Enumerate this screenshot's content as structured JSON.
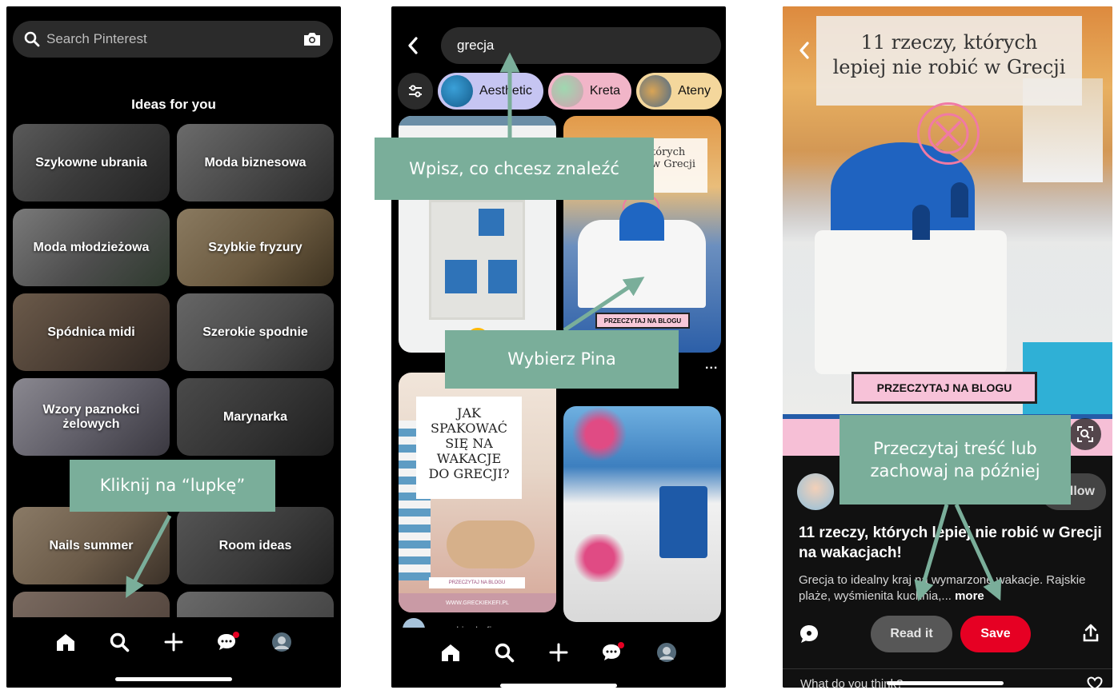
{
  "screen1": {
    "search_placeholder": "Search Pinterest",
    "ideas_title": "Ideas for you",
    "tiles": [
      "Szykowne ubrania",
      "Moda biznesowa",
      "Moda młodzieżowa",
      "Szybkie fryzury",
      "Spódnica midi",
      "Szerokie spodnie",
      "Wzory paznokci żelowych",
      "Marynarka",
      "Nails summer",
      "Room ideas"
    ],
    "callout": "Kliknij na “lupkę”"
  },
  "screen2": {
    "query": "grecja",
    "chips": [
      "Aesthetic",
      "Kreta",
      "Ateny"
    ],
    "pin_overlay_top": "tórych\nw Grecji",
    "pin_read_label": "PRZECZYTAJ NA BLOGU",
    "pack_text": "JAK\nSPAKOWAĆ\nSIĘ NA\nWAKACJE\nDO GRECJI?",
    "pack_blog": "PRZECZYTAJ NA BLOGU",
    "pack_site": "WWW.GRECKIEKEFI.PL",
    "creator_name": "greckie_kefi",
    "more_dots": "...",
    "callout_search": "Wpisz, co chcesz znaleźć",
    "callout_pin": "Wybierz Pina"
  },
  "screen3": {
    "hero_title": "11 rzeczy, których\nlepiej nie robić w Grecji",
    "hero_read_label": "PRZECZYTAJ NA BLOGU",
    "follow_label": "llow",
    "pin_title": "11 rzeczy, których lepiej nie robić w Grecji na wakacjach!",
    "description": "Grecja to idealny kraj na wymarzone wakacje. Rajskie plaże, wyśmienita kuchnia,...",
    "more": "more",
    "read_it": "Read it",
    "save": "Save",
    "comment_prompt": "What do you think?",
    "callout": "Przeczytaj treść lub\nzachowaj na później"
  },
  "colors": {
    "callout": "#7aae9a",
    "save_red": "#e60023",
    "dark_surface": "#2b2b2b",
    "pink_band": "#f6bfd6"
  }
}
